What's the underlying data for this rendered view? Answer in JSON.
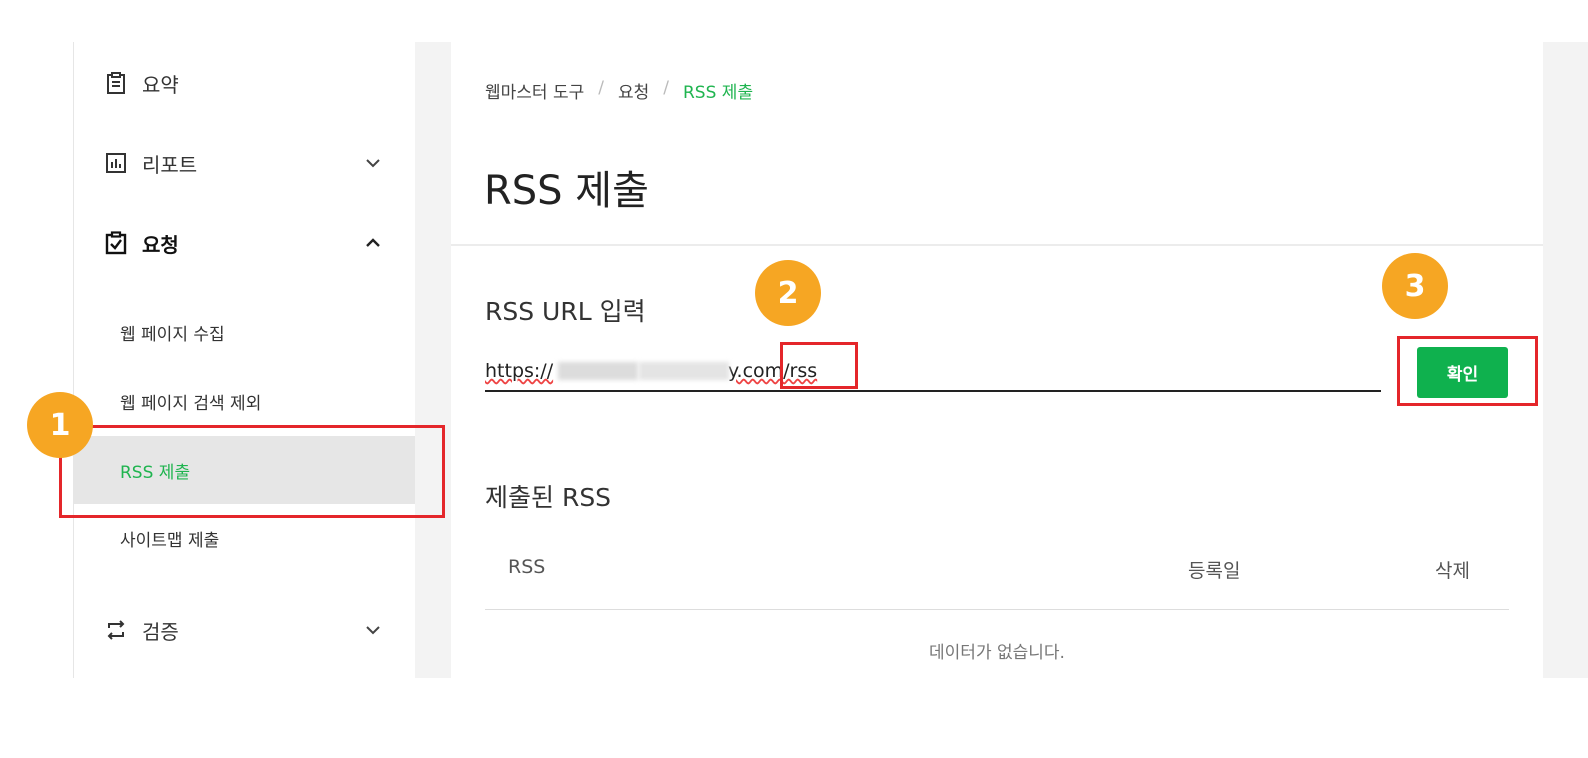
{
  "sidebar": {
    "summary": "요약",
    "report": "리포트",
    "request": "요청",
    "request_sub": [
      "웹 페이지 수집",
      "웹 페이지 검색 제외",
      "RSS 제출",
      "사이트맵 제출"
    ],
    "verify": "검증"
  },
  "breadcrumb": {
    "root": "웹마스터 도구",
    "section": "요청",
    "current": "RSS 제출",
    "separator": "/"
  },
  "page_title": "RSS 제출",
  "rss_input": {
    "label": "RSS URL 입력",
    "value_prefix": "https://",
    "value_suffix": "y.com/rss"
  },
  "confirm_label": "확인",
  "submitted": {
    "title": "제출된 RSS",
    "columns": [
      "RSS",
      "등록일",
      "삭제"
    ],
    "empty": "데이터가 없습니다."
  },
  "annotations": [
    "1",
    "2",
    "3"
  ],
  "colors": {
    "accent": "#1fb44f",
    "button": "#0fb14e",
    "annotation_box": "#e4262a",
    "badge": "#f6a623"
  }
}
